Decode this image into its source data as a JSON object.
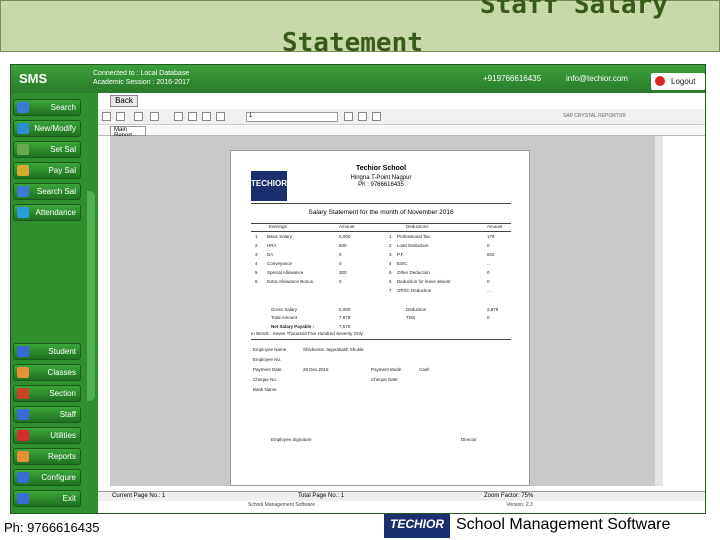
{
  "slide": {
    "title_line1": "Staff Salary",
    "title_line2": "Statement",
    "phone": "Ph: 9766616435",
    "brand": "TECHIOR",
    "tagline": "School Management Software"
  },
  "app": {
    "logo": "SMS",
    "connected": "Connected to : Local Database",
    "session": "Academic Session : 2016-2017",
    "phone": "+919766616435",
    "email": "info@techior.com",
    "logout": "Logout",
    "colors": {
      "green": "#2f8f2f",
      "banner": "#c8d8a8"
    }
  },
  "sidebar": {
    "top_items": [
      {
        "label": "Search",
        "icon": "search-icon",
        "color": "#3a7bd5"
      },
      {
        "label": "New/Modify",
        "icon": "edit-icon",
        "color": "#2b8cd6"
      },
      {
        "label": "Set Sal",
        "icon": "settings-icon",
        "color": "#6aa84f"
      },
      {
        "label": "Pay Sal",
        "icon": "pay-icon",
        "color": "#d6aa2b"
      },
      {
        "label": "Search Sal",
        "icon": "search-salary-icon",
        "color": "#3a7bd5"
      },
      {
        "label": "Attendance",
        "icon": "attendance-icon",
        "color": "#2b9cd6"
      }
    ],
    "bottom_items": [
      {
        "label": "Student",
        "icon": "student-icon",
        "color": "#3a6ad5"
      },
      {
        "label": "Classes",
        "icon": "classes-icon",
        "color": "#e69138"
      },
      {
        "label": "Section",
        "icon": "section-icon",
        "color": "#cc4125"
      },
      {
        "label": "Staff",
        "icon": "staff-icon",
        "color": "#3a6ad5"
      },
      {
        "label": "Utilities",
        "icon": "utilities-icon",
        "color": "#d62b2b"
      },
      {
        "label": "Reports",
        "icon": "reports-icon",
        "color": "#e69138"
      },
      {
        "label": "Configure",
        "icon": "configure-icon",
        "color": "#3a6ad5"
      },
      {
        "label": "Exit",
        "icon": "exit-icon",
        "color": "#3a6ad5"
      }
    ]
  },
  "viewer": {
    "back": "Back",
    "page_value": "1",
    "sap": "SAP CRYSTAL REPORTS®",
    "tab": "Main Report",
    "status_page": "Current Page No.: 1",
    "status_total": "Total Page No.: 1",
    "status_zoom": "Zoom Factor: 75%",
    "status_footer": "School Management Software",
    "status_version": "Version: 2.3"
  },
  "report": {
    "school": "Techior School",
    "address": "Hingna T-Point Nagpur",
    "ph": "Ph : 9766616435",
    "heading": "Salary Statement for the month of November 2016",
    "earnings_header": [
      "",
      "Earnings",
      "Amount"
    ],
    "deductions_header": [
      "",
      "Deductions",
      "Amount"
    ],
    "earnings": [
      {
        "n": "1",
        "name": "Basic Salary",
        "amt": "6,000"
      },
      {
        "n": "2",
        "name": "HRA",
        "amt": "600"
      },
      {
        "n": "3",
        "name": "DA",
        "amt": "0"
      },
      {
        "n": "4",
        "name": "Conveyance",
        "amt": "0"
      },
      {
        "n": "5",
        "name": "Special Allowance",
        "amt": "300"
      },
      {
        "n": "6",
        "name": "Extra Allowance Bonus",
        "amt": "0"
      }
    ],
    "deductions": [
      {
        "n": "1",
        "name": "Professional Tax",
        "amt": "175"
      },
      {
        "n": "2",
        "name": "Loan Deduction",
        "amt": "0"
      },
      {
        "n": "3",
        "name": "P.F.",
        "amt": "602"
      },
      {
        "n": "4",
        "name": "ESIC",
        "amt": "..."
      },
      {
        "n": "5",
        "name": "Other Deduction",
        "amt": "0"
      },
      {
        "n": "6",
        "name": "Deduction for leave absent",
        "amt": "0"
      },
      {
        "n": "7",
        "name": "GPSC Deduction",
        "amt": "..."
      }
    ],
    "gross_label": "Gross Salary",
    "gross_value": "5,000",
    "deduction_label": "Deduction",
    "deduction_value": "2,879",
    "total_label": "Total Amount",
    "total_value": "7,878",
    "tds_label": "TDS",
    "tds_value": "0",
    "net_label": "Net Salary Payable :",
    "net_value": "7,570",
    "in_words": "In Words : Seven Thousand Five Hundred Seventy Only",
    "employee_name_label": "Employee Name",
    "employee_name": "Shivkumar Jayprakash Shukla",
    "employee_no_label": "Employee No.",
    "payment_date_label": "Payment Date",
    "payment_date": "28 Dec 2016",
    "payment_mode_label": "Payment Mode",
    "payment_mode": "Cash",
    "cheque_no_label": "Cheque No.",
    "cheque_date_label": "Cheque Date",
    "bank_label": "Bank Name",
    "signature_label": "Employee Signature",
    "director_label": "Director"
  }
}
